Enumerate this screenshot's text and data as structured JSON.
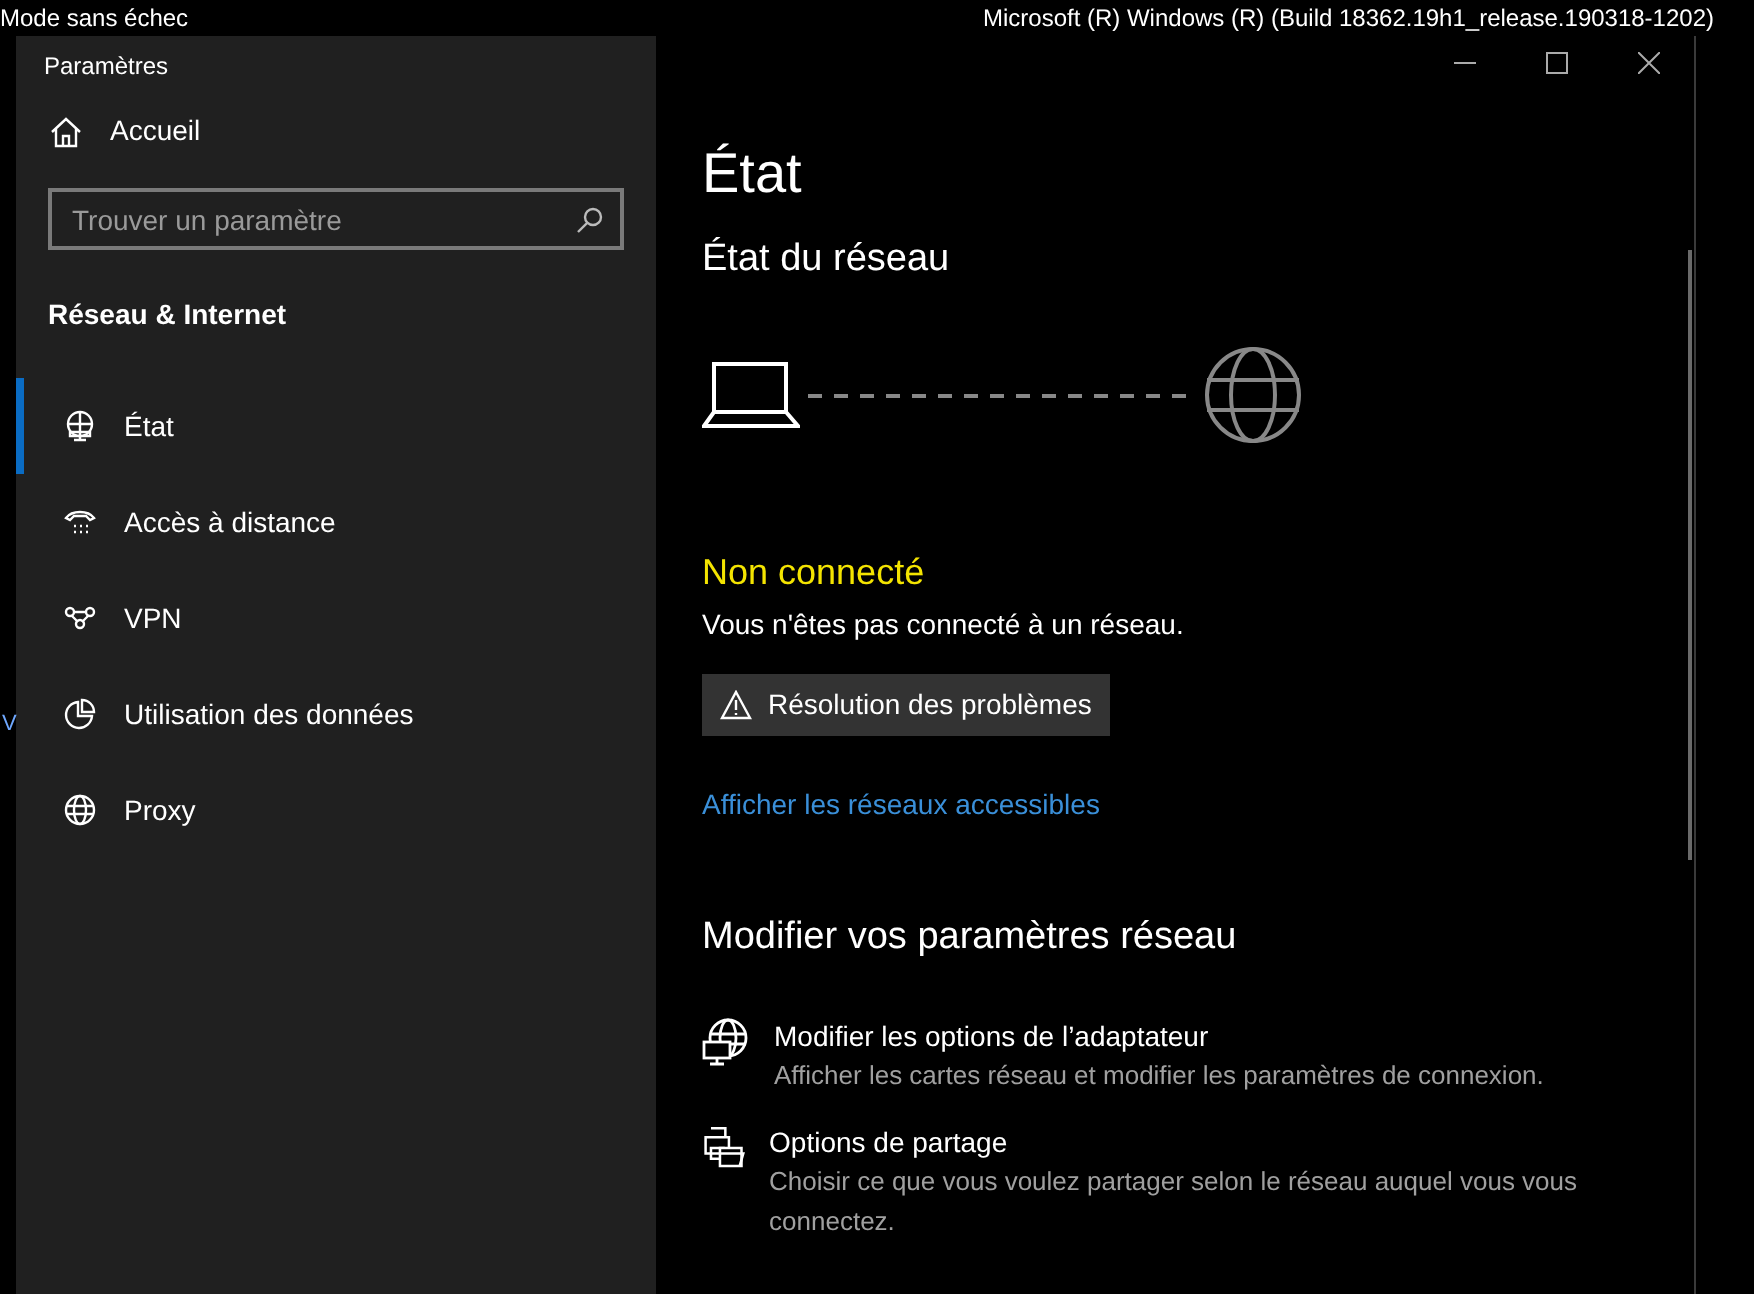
{
  "desktop": {
    "mode_label": "Mode sans échec",
    "build_label": "Microsoft (R) Windows (R) (Build 18362.19h1_release.190318-1202)",
    "fragment": "V"
  },
  "window": {
    "title": "Paramètres"
  },
  "sidebar": {
    "home": "Accueil",
    "search": {
      "placeholder": "Trouver un paramètre"
    },
    "section": "Réseau & Internet",
    "items": [
      {
        "label": "État",
        "kind": "status",
        "selected": true
      },
      {
        "label": "Accès à distance",
        "kind": "dialup",
        "selected": false
      },
      {
        "label": "VPN",
        "kind": "vpn",
        "selected": false
      },
      {
        "label": "Utilisation des données",
        "kind": "data",
        "selected": false
      },
      {
        "label": "Proxy",
        "kind": "proxy",
        "selected": false
      }
    ]
  },
  "content": {
    "title": "État",
    "network_heading": "État du réseau",
    "connection_status": "Non connecté",
    "status_description": "Vous n'êtes pas connecté à un réseau.",
    "troubleshoot_button": "Résolution des problèmes",
    "networks_link": "Afficher les réseaux accessibles",
    "settings_heading": "Modifier vos paramètres réseau",
    "options": [
      {
        "kind": "adapter",
        "title": "Modifier les options de l’adaptateur",
        "description": "Afficher les cartes réseau et modifier les paramètres de connexion."
      },
      {
        "kind": "sharing",
        "title": "Options de partage",
        "description": "Choisir ce que vous voulez partager selon le réseau auquel vous vous connectez."
      }
    ]
  }
}
